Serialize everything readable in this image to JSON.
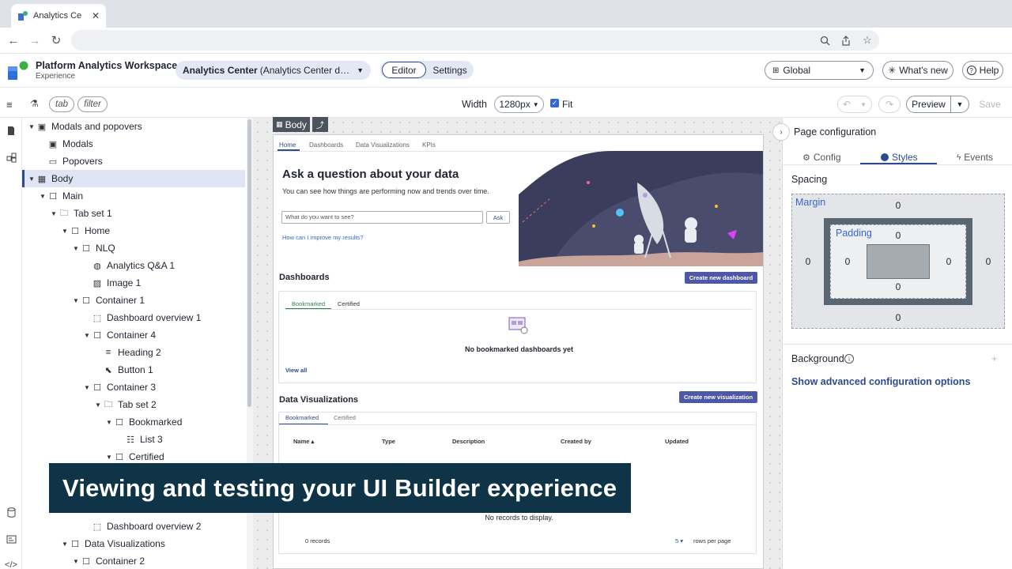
{
  "browser": {
    "tab_title": "Analytics Ce",
    "url": ""
  },
  "app": {
    "workspace_title": "Platform Analytics Workspace",
    "workspace_subtitle": "Experience",
    "experience_name": "Analytics Center",
    "experience_detail": "(Analytics Center def...",
    "mode_editor": "Editor",
    "mode_settings": "Settings",
    "global_label": "Global",
    "whats_new": "What's new",
    "help": "Help"
  },
  "toolbar": {
    "chip_tab": "tab",
    "chip_filter": "filter",
    "width_label": "Width",
    "width_value": "1280px",
    "fit_label": "Fit",
    "preview": "Preview",
    "save": "Save"
  },
  "tree": [
    {
      "label": "Modals and popovers",
      "depth": 0,
      "twisty": "open",
      "icon": "component-icon"
    },
    {
      "label": "Modals",
      "depth": 1,
      "twisty": "",
      "icon": "component-icon"
    },
    {
      "label": "Popovers",
      "depth": 1,
      "twisty": "",
      "icon": "popover-icon"
    },
    {
      "label": "Body",
      "depth": 0,
      "twisty": "open",
      "icon": "layout-icon",
      "selected": true
    },
    {
      "label": "Main",
      "depth": 1,
      "twisty": "open",
      "icon": "container-icon"
    },
    {
      "label": "Tab set 1",
      "depth": 2,
      "twisty": "open",
      "icon": "tabset-icon"
    },
    {
      "label": "Home",
      "depth": 3,
      "twisty": "open",
      "icon": "container-icon"
    },
    {
      "label": "NLQ",
      "depth": 4,
      "twisty": "open",
      "icon": "container-icon"
    },
    {
      "label": "Analytics Q&A 1",
      "depth": 5,
      "twisty": "",
      "icon": "qa-icon"
    },
    {
      "label": "Image 1",
      "depth": 5,
      "twisty": "",
      "icon": "image-icon"
    },
    {
      "label": "Container 1",
      "depth": 4,
      "twisty": "open",
      "icon": "container-icon"
    },
    {
      "label": "Dashboard overview 1",
      "depth": 5,
      "twisty": "",
      "icon": "dashboard-icon"
    },
    {
      "label": "Container 4",
      "depth": 5,
      "twisty": "open",
      "icon": "container-icon"
    },
    {
      "label": "Heading 2",
      "depth": 6,
      "twisty": "",
      "icon": "heading-icon"
    },
    {
      "label": "Button 1",
      "depth": 6,
      "twisty": "",
      "icon": "button-icon"
    },
    {
      "label": "Container 3",
      "depth": 5,
      "twisty": "open",
      "icon": "container-icon"
    },
    {
      "label": "Tab set 2",
      "depth": 6,
      "twisty": "open",
      "icon": "tabset-icon"
    },
    {
      "label": "Bookmarked",
      "depth": 7,
      "twisty": "open",
      "icon": "container-icon"
    },
    {
      "label": "List 3",
      "depth": 8,
      "twisty": "",
      "icon": "list-icon"
    },
    {
      "label": "Certified",
      "depth": 7,
      "twisty": "open",
      "icon": "container-icon"
    },
    {
      "label": "",
      "depth": 0,
      "twisty": "",
      "icon": ""
    },
    {
      "label": "",
      "depth": 0,
      "twisty": "",
      "icon": ""
    },
    {
      "label": "",
      "depth": 0,
      "twisty": "",
      "icon": ""
    },
    {
      "label": "Dashboard overview 2",
      "depth": 5,
      "twisty": "",
      "icon": "dashboard-icon"
    },
    {
      "label": "Data Visualizations",
      "depth": 3,
      "twisty": "open",
      "icon": "container-icon"
    },
    {
      "label": "Container 2",
      "depth": 4,
      "twisty": "open",
      "icon": "container-icon"
    }
  ],
  "canvas": {
    "body_badge": "Body",
    "page_tabs": [
      "Home",
      "Dashboards",
      "Data Visualizations",
      "KPIs"
    ],
    "hero_title": "Ask a question about your data",
    "hero_subtitle": "You can see how things are performing now and trends over time.",
    "ask_placeholder": "What do you want to see?",
    "ask_button": "Ask",
    "improve_link": "How can I improve my results?",
    "dashboards_title": "Dashboards",
    "create_dashboard": "Create new dashboard",
    "dash_tabs": [
      "Bookmarked",
      "Certified"
    ],
    "empty_dashboards": "No bookmarked dashboards yet",
    "view_all": "View all",
    "dataviz_title": "Data Visualizations",
    "create_viz": "Create new visualization",
    "viz_tabs": [
      "Bookmarked",
      "Certified"
    ],
    "table_headers": [
      "Name ▴",
      "Type",
      "Description",
      "Created by",
      "Updated"
    ],
    "no_records": "No records to display.",
    "records_count": "0 records",
    "rows_value": "5 ▾",
    "rows_label": "rows per page"
  },
  "panel": {
    "title": "Page configuration",
    "tabs": [
      "Config",
      "Styles",
      "Events"
    ],
    "spacing_title": "Spacing",
    "margin_label": "Margin",
    "padding_label": "Padding",
    "margin": {
      "top": "0",
      "right": "0",
      "bottom": "0",
      "left": "0"
    },
    "padding": {
      "top": "0",
      "right": "0",
      "bottom": "0",
      "left": "0"
    },
    "background_title": "Background",
    "advanced_link": "Show advanced configuration options"
  },
  "caption": "Viewing and testing your UI Builder experience",
  "colors": {
    "accent": "#2d4b8e",
    "primary_button": "#4e58a8",
    "caption_bg": "#0f3347",
    "selected_row": "#dfe5f5"
  }
}
